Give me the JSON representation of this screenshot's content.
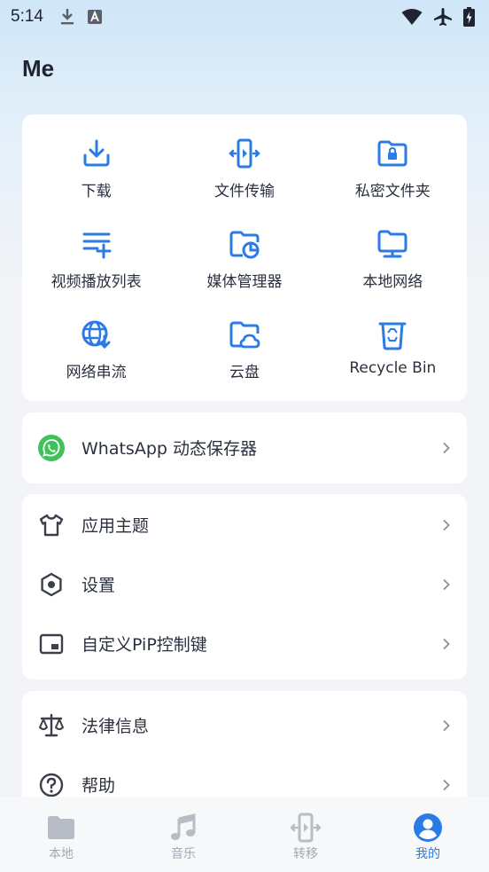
{
  "status_bar": {
    "time": "5:14"
  },
  "page": {
    "title": "Me"
  },
  "colors": {
    "accent": "#2b7be4",
    "whatsapp": "#3fc257",
    "icon_dark": "#3a3f4a",
    "nav_inactive": "#b8bcc5"
  },
  "quick_actions": [
    {
      "label": "下载",
      "icon": "download-icon"
    },
    {
      "label": "文件传输",
      "icon": "file-transfer-icon"
    },
    {
      "label": "私密文件夹",
      "icon": "private-folder-icon"
    },
    {
      "label": "视频播放列表",
      "icon": "playlist-add-icon"
    },
    {
      "label": "媒体管理器",
      "icon": "media-manager-icon"
    },
    {
      "label": "本地网络",
      "icon": "local-network-icon"
    },
    {
      "label": "网络串流",
      "icon": "network-stream-icon"
    },
    {
      "label": "云盘",
      "icon": "cloud-drive-icon"
    },
    {
      "label": "Recycle Bin",
      "icon": "recycle-bin-icon"
    }
  ],
  "whatsapp": {
    "label": "WhatsApp 动态保存器",
    "icon": "whatsapp-icon"
  },
  "settings_menu": [
    {
      "label": "应用主题",
      "icon": "tshirt-icon"
    },
    {
      "label": "设置",
      "icon": "settings-icon"
    },
    {
      "label": "自定义PiP控制键",
      "icon": "pip-icon"
    }
  ],
  "legal_menu": [
    {
      "label": "法律信息",
      "icon": "scale-icon"
    },
    {
      "label": "帮助",
      "icon": "help-icon"
    }
  ],
  "bottom_nav": [
    {
      "label": "本地",
      "icon": "folder-icon",
      "active": false
    },
    {
      "label": "音乐",
      "icon": "music-icon",
      "active": false
    },
    {
      "label": "转移",
      "icon": "transfer-icon",
      "active": false
    },
    {
      "label": "我的",
      "icon": "profile-icon",
      "active": true
    }
  ]
}
